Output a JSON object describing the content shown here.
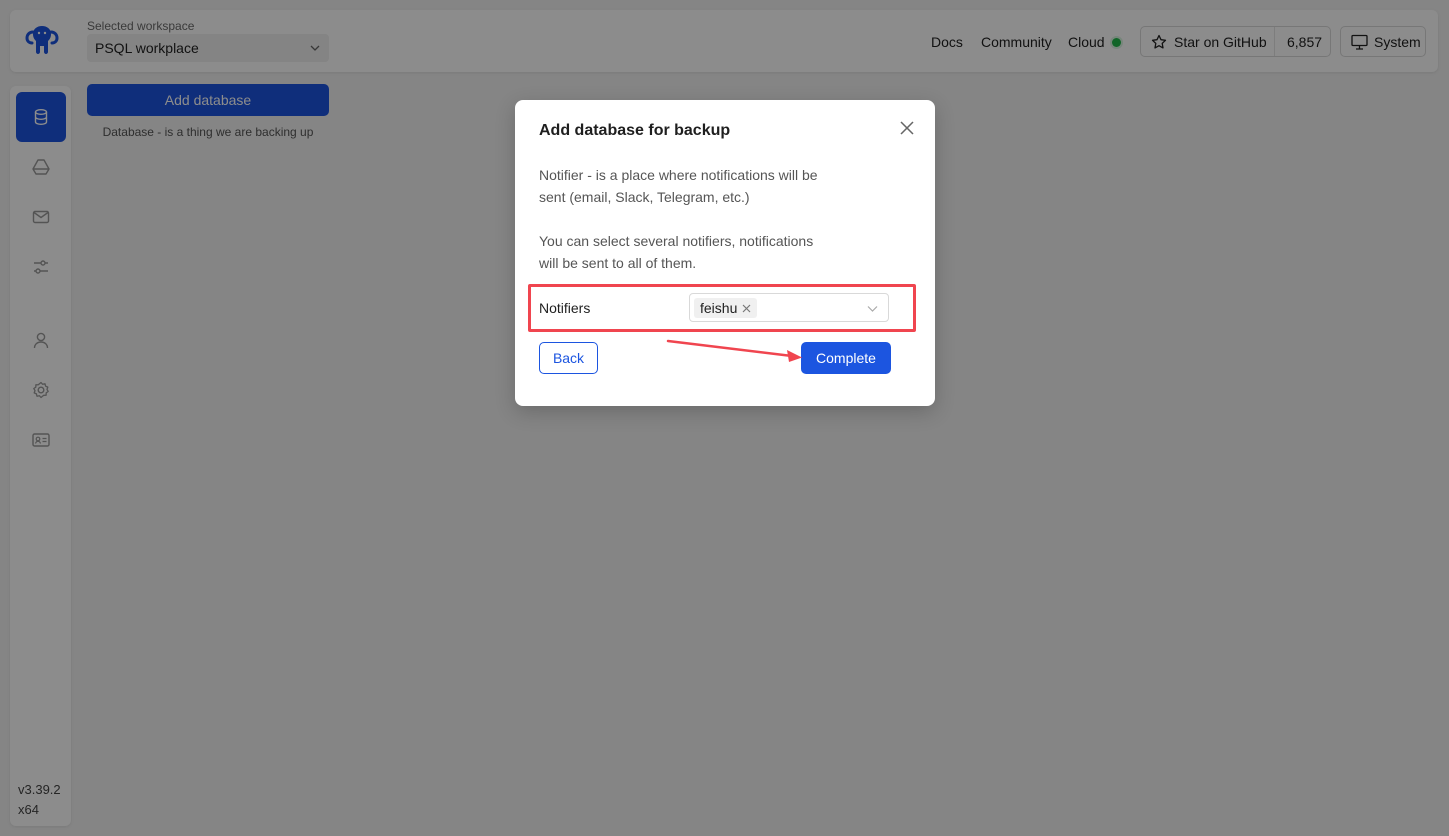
{
  "header": {
    "workspace_caption": "Selected workspace",
    "workspace_value": "PSQL workplace",
    "links": {
      "docs": "Docs",
      "community": "Community",
      "cloud": "Cloud"
    },
    "cloud_status_color": "#1fb84a",
    "github": {
      "label": "Star on GitHub",
      "count": "6,857"
    },
    "system": {
      "label": "System"
    }
  },
  "sidebar": {
    "items": [
      {
        "icon": "database-icon",
        "active": true
      },
      {
        "icon": "storage-drive-icon",
        "active": false
      },
      {
        "icon": "mail-icon",
        "active": false
      },
      {
        "icon": "sliders-icon",
        "active": false
      },
      {
        "icon": "user-icon",
        "active": false
      },
      {
        "icon": "gear-icon",
        "active": false
      },
      {
        "icon": "id-card-icon",
        "active": false
      }
    ],
    "version": "v3.39.2",
    "arch": "x64"
  },
  "main": {
    "add_database_label": "Add database",
    "add_database_caption": "Database - is a thing we are backing up"
  },
  "modal": {
    "title": "Add database for backup",
    "para1_line1": "Notifier - is a place where notifications will be",
    "para1_line2": "sent (email, Slack, Telegram, etc.)",
    "para2_line1": "You can select several notifiers, notifications",
    "para2_line2": "will be sent to all of them.",
    "field_label": "Notifiers",
    "selected_tags": [
      "feishu"
    ],
    "back_label": "Back",
    "complete_label": "Complete"
  },
  "colors": {
    "accent": "#1c55e0",
    "highlight": "#f0454f",
    "overlay": "rgba(0,0,0,0.45)"
  }
}
